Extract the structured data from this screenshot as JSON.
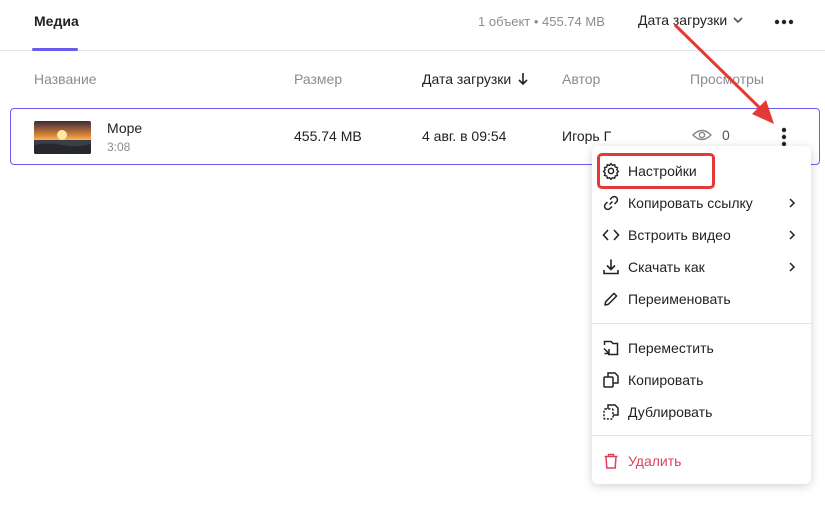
{
  "header": {
    "tab_media": "Медиа",
    "object_info": "1 объект • 455.74 MB",
    "sort_label": "Дата загрузки"
  },
  "columns": {
    "name": "Название",
    "size": "Размер",
    "uploaded": "Дата загрузки",
    "author": "Автор",
    "views": "Просмотры"
  },
  "row": {
    "title": "Море",
    "duration": "3:08",
    "size": "455.74 MB",
    "uploaded": "4 авг. в 09:54",
    "author": "Игорь Г",
    "views": "0"
  },
  "menu": {
    "items": [
      {
        "label": "Настройки",
        "icon": "gear-icon",
        "submenu": false
      },
      {
        "label": "Копировать ссылку",
        "icon": "link-icon",
        "submenu": true
      },
      {
        "label": "Встроить видео",
        "icon": "code-icon",
        "submenu": true
      },
      {
        "label": "Скачать как",
        "icon": "download-icon",
        "submenu": true
      },
      {
        "label": "Переименовать",
        "icon": "pencil-icon",
        "submenu": false
      },
      {
        "label": "Переместить",
        "icon": "move-icon",
        "submenu": false
      },
      {
        "label": "Копировать",
        "icon": "copy-icon",
        "submenu": false
      },
      {
        "label": "Дублировать",
        "icon": "duplicate-icon",
        "submenu": false
      },
      {
        "label": "Удалить",
        "icon": "trash-icon",
        "submenu": false
      }
    ]
  },
  "colors": {
    "accent": "#6b5cf0",
    "danger": "#e0405a",
    "annotation": "#e53935"
  }
}
